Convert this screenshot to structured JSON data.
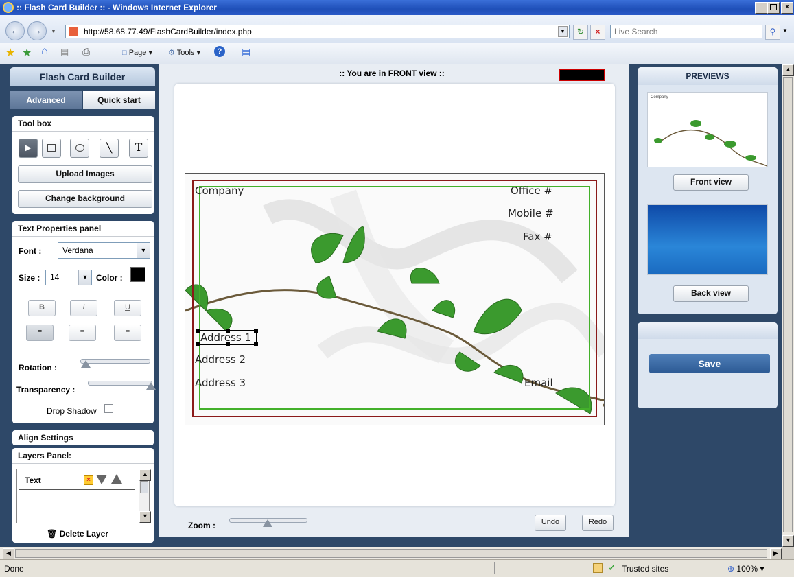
{
  "window": {
    "title": ":: Flash Card Builder :: - Windows Internet Explorer",
    "min": "_",
    "max": " ",
    "close": "×"
  },
  "browser": {
    "url": "http://58.68.77.49/FlashCardBuilder/index.php",
    "search_placeholder": "Live Search",
    "cmd_page": "Page",
    "cmd_tools": "Tools"
  },
  "left": {
    "app_title": "Flash Card Builder",
    "tab_advanced": "Advanced",
    "tab_quickstart": "Quick start",
    "toolbox_title": "Tool box",
    "tool_text_glyph": "T",
    "upload_images": "Upload Images",
    "change_background": "Change background",
    "text_panel_title": "Text Properties panel",
    "font_label": "Font :",
    "font_value": "Verdana",
    "size_label": "Size :",
    "size_value": "14",
    "color_label": "Color :",
    "text_color": "#000000",
    "bold": "B",
    "italic": "I",
    "underline": "U",
    "rotation_label": "Rotation :",
    "rotation_value": 0.0,
    "transparency_label": "Transparency :",
    "transparency_value": 1.0,
    "drop_shadow_label": "Drop Shadow",
    "align_settings": "Align Settings",
    "layers_title": "Layers Panel:",
    "layer_item": "Text",
    "delete_layer": "Delete Layer"
  },
  "center": {
    "view_title": ":: You are in FRONT view ::",
    "zoom_label": "Zoom :",
    "zoom_value": 0.5,
    "undo": "Undo",
    "redo": "Redo",
    "card": {
      "company": "Company",
      "office": "Office #",
      "mobile": "Mobile #",
      "fax": "Fax #",
      "address1": "Address 1",
      "address2": "Address 2",
      "address3": "Address 3",
      "email": "Email"
    }
  },
  "right": {
    "previews_title": "PREVIEWS",
    "front_view": "Front view",
    "back_view": "Back view",
    "save": "Save",
    "preview_company": "Company"
  },
  "status": {
    "left": "Done",
    "zone": "Trusted sites",
    "zoom": "100%"
  }
}
